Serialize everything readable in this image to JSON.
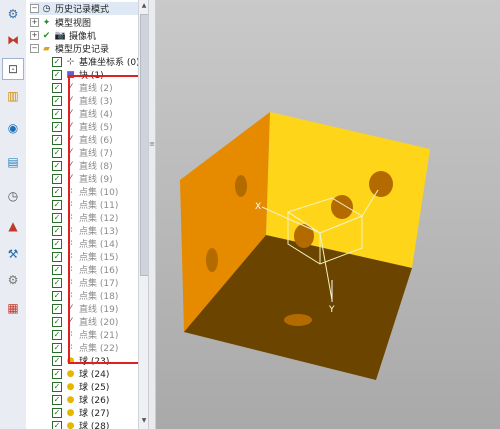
{
  "toolbar": {
    "buttons": [
      {
        "name": "assembly-nav",
        "glyph": "⚙"
      },
      {
        "name": "constraint-nav",
        "glyph": "⧓"
      },
      {
        "name": "part-nav",
        "glyph": "⊡"
      },
      {
        "name": "reuse-library",
        "glyph": "▥"
      },
      {
        "name": "web-browser",
        "glyph": "◉"
      },
      {
        "name": "history",
        "glyph": "▤"
      },
      {
        "name": "clock",
        "glyph": "◷"
      },
      {
        "name": "color-palette",
        "glyph": "▲"
      },
      {
        "name": "process-studio",
        "glyph": "⚒"
      },
      {
        "name": "roles",
        "glyph": "⚙"
      },
      {
        "name": "system-materials",
        "glyph": "▦"
      }
    ]
  },
  "tree": {
    "header": "历史记录模式",
    "model_views": "模型视图",
    "camera": "摄像机",
    "model_history": "模型历史记录",
    "datum_csys": "基准坐标系 (0)",
    "block": "块 (1)",
    "items": [
      {
        "label": "直线 (2)",
        "type": "line"
      },
      {
        "label": "直线 (3)",
        "type": "line"
      },
      {
        "label": "直线 (4)",
        "type": "line"
      },
      {
        "label": "直线 (5)",
        "type": "line"
      },
      {
        "label": "直线 (6)",
        "type": "line"
      },
      {
        "label": "直线 (7)",
        "type": "line"
      },
      {
        "label": "直线 (8)",
        "type": "line"
      },
      {
        "label": "直线 (9)",
        "type": "line"
      },
      {
        "label": "点集 (10)",
        "type": "pointset"
      },
      {
        "label": "点集 (11)",
        "type": "pointset"
      },
      {
        "label": "点集 (12)",
        "type": "pointset"
      },
      {
        "label": "点集 (13)",
        "type": "pointset"
      },
      {
        "label": "点集 (14)",
        "type": "pointset"
      },
      {
        "label": "点集 (15)",
        "type": "pointset"
      },
      {
        "label": "点集 (16)",
        "type": "pointset"
      },
      {
        "label": "点集 (17)",
        "type": "pointset"
      },
      {
        "label": "点集 (18)",
        "type": "pointset"
      },
      {
        "label": "直线 (19)",
        "type": "line"
      },
      {
        "label": "直线 (20)",
        "type": "line"
      },
      {
        "label": "点集 (21)",
        "type": "pointset"
      },
      {
        "label": "点集 (22)",
        "type": "pointset"
      },
      {
        "label": "球 (23)",
        "type": "sphere"
      },
      {
        "label": "球 (24)",
        "type": "sphere"
      },
      {
        "label": "球 (25)",
        "type": "sphere"
      },
      {
        "label": "球 (26)",
        "type": "sphere"
      },
      {
        "label": "球 (27)",
        "type": "sphere"
      },
      {
        "label": "球 (28)",
        "type": "sphere"
      }
    ]
  },
  "viewport": {
    "axis_x": "X",
    "axis_y": "Y",
    "colors": {
      "top": "#ffd51a",
      "left": "#e68a00",
      "bottom": "#6b4400",
      "hole": "#b36b00",
      "highlight": "#e02020"
    }
  }
}
